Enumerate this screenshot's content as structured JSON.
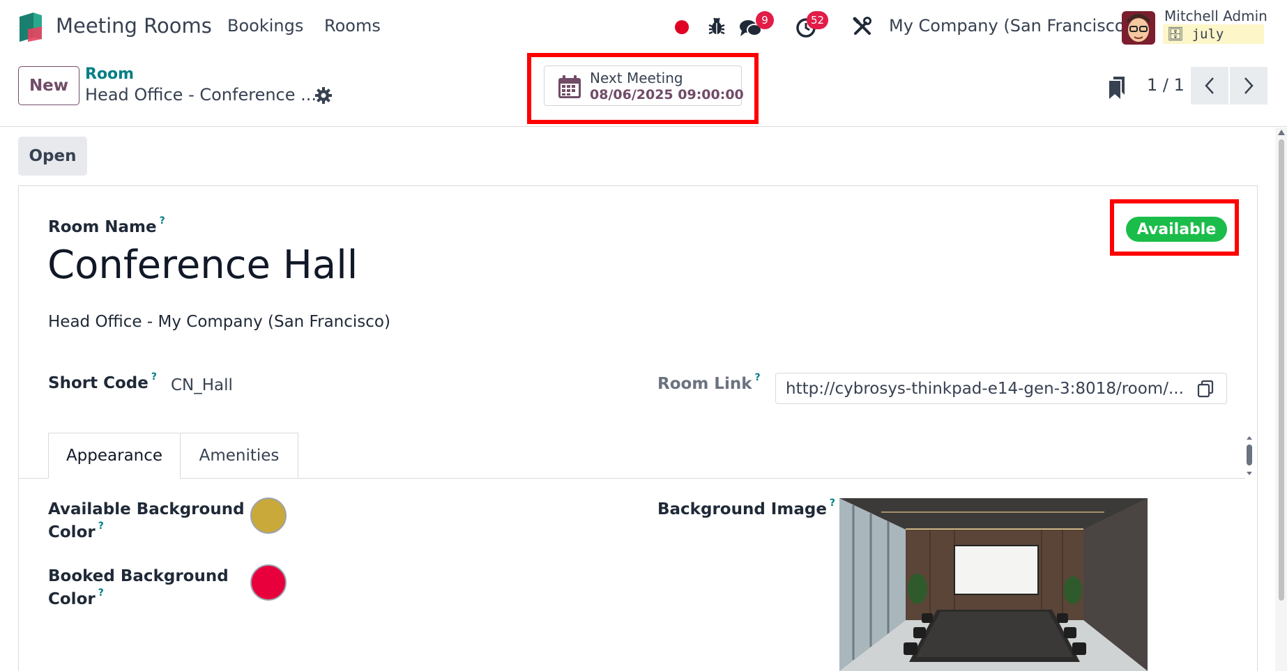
{
  "navbar": {
    "app_name": "Meeting Rooms",
    "menu": [
      "Bookings",
      "Rooms"
    ],
    "messages_count": "9",
    "activities_count": "52",
    "company": "My Company (San Francisco)",
    "user_name": "Mitchell Admin",
    "database": "july",
    "icons": [
      "record-dot-icon",
      "bug-icon",
      "chat-icon",
      "clock-icon",
      "tools-icon"
    ]
  },
  "control_panel": {
    "new_label": "New",
    "breadcrumb_parent": "Room",
    "breadcrumb_current": "Head Office - Conference ...",
    "next_meeting_label": "Next Meeting",
    "next_meeting_value": "08/06/2025 09:00:00",
    "pager": "1 / 1"
  },
  "status_bar": {
    "open_label": "Open"
  },
  "form": {
    "room_name_label": "Room Name",
    "help_mark": "?",
    "room_name": "Conference Hall",
    "location": "Head Office - My Company (San Francisco)",
    "short_code_label": "Short Code",
    "short_code": "CN_Hall",
    "room_link_label": "Room Link",
    "room_link": "http://cybrosys-thinkpad-e14-gen-3:8018/room/...",
    "status": "Available",
    "tabs": [
      {
        "label": "Appearance"
      },
      {
        "label": "Amenities"
      }
    ],
    "available_bg_label_1": "Available Background",
    "available_bg_label_2": "Color",
    "available_bg_color": "#c8a93a",
    "booked_bg_label_1": "Booked Background",
    "booked_bg_label_2": "Color",
    "booked_bg_color": "#e8003c",
    "background_image_label": "Background Image"
  },
  "colors": {
    "brand": "#714B67",
    "accent_teal": "#017e84",
    "status_green": "#1bbd4a",
    "badge_red": "#e11d48",
    "highlight_red": "#ff0000"
  }
}
